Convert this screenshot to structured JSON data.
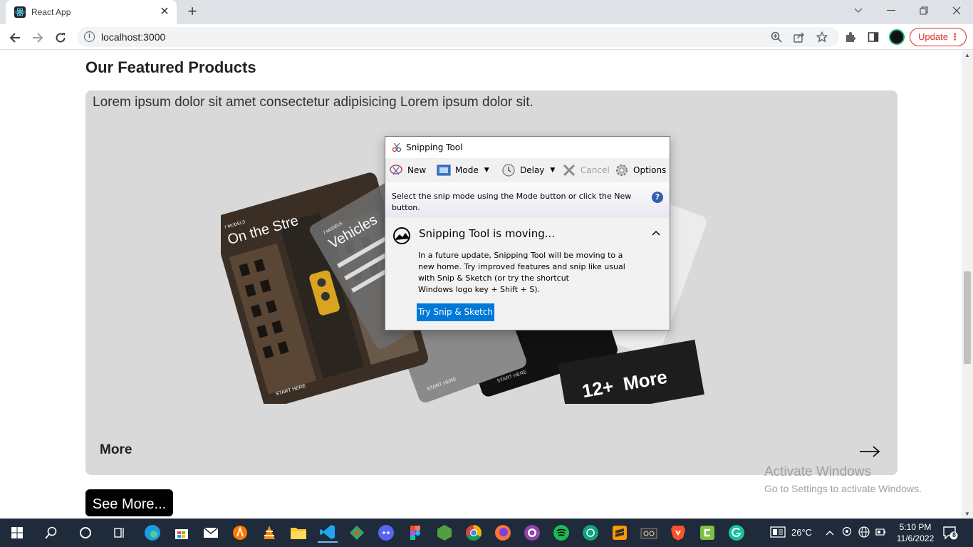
{
  "browser": {
    "tab_title": "React App",
    "tab_close": "✕",
    "new_tab": "+",
    "url": "localhost:3000",
    "update_label": "Update",
    "update_menu": "⋮"
  },
  "page": {
    "section_title": "Our Featured Products",
    "card": {
      "description": "Lorem ipsum dolor sit amet consectetur adipisicing Lorem ipsum dolor sit.",
      "more_label": "More",
      "collage": {
        "card1_small": "7 MODELS",
        "card1_title": "On the Stre",
        "card1_footer": "START HERE",
        "card2_small": "7 MODELS",
        "card2_title": "Vehicles",
        "card2_footer": "START HERE",
        "card3_footer": "START HERE",
        "banner": "12+  More"
      }
    },
    "see_more_label": "See More..."
  },
  "watermark": {
    "line1": "Activate Windows",
    "line2": "Go to Settings to activate Windows."
  },
  "snipping_tool": {
    "title": "Snipping Tool",
    "toolbar": {
      "new": "New",
      "mode": "Mode",
      "delay": "Delay",
      "cancel": "Cancel",
      "options": "Options"
    },
    "hint": "Select the snip mode using the Mode button or click the New button.",
    "help": "?",
    "notice": {
      "heading": "Snipping Tool is moving...",
      "body_1": "In a future update, Snipping Tool will be moving to a new home. Try improved features and snip like usual with Snip & Sketch (or try the shortcut",
      "body_2": "Windows logo key + Shift + S).",
      "button": "Try Snip & Sketch"
    }
  },
  "taskbar": {
    "weather": "26°C",
    "time": "5:10 PM",
    "date": "11/6/2022",
    "notification_count": "8"
  },
  "colors": {
    "card_bg": "#d9d9d9",
    "update_accent": "#d93025",
    "snip_button": "#0078d7",
    "taskbar_bg": "#1f2b3a"
  }
}
